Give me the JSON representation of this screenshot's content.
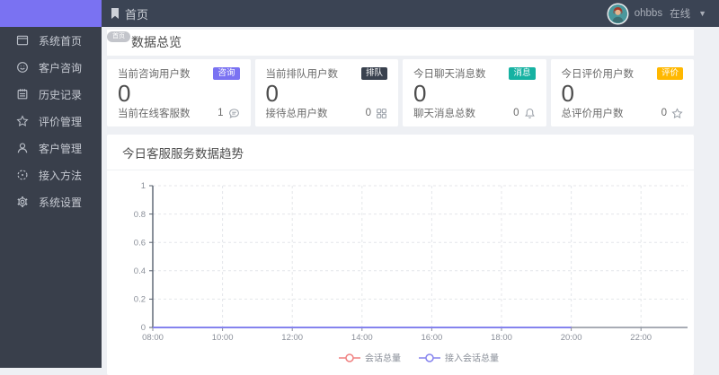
{
  "colors": {
    "logo_purple": "#7a72f2",
    "header_bg": "#3b4454",
    "sidebar_bg": "#393f4b",
    "page_bg": "#eef0f4",
    "axis_y": "#57606e",
    "axis_x": "#a8acb5",
    "grid_line": "#e4e6ea",
    "tick_label": "#8a8f99"
  },
  "header": {
    "breadcrumb": "首页",
    "username": "ohbbs",
    "status": "在线"
  },
  "sidebar": {
    "items": [
      {
        "label": "系统首页",
        "icon": "window-icon"
      },
      {
        "label": "客户咨询",
        "icon": "chat-smile-icon"
      },
      {
        "label": "历史记录",
        "icon": "notebook-icon"
      },
      {
        "label": "评价管理",
        "icon": "star-icon"
      },
      {
        "label": "客户管理",
        "icon": "user-icon"
      },
      {
        "label": "接入方法",
        "icon": "plug-circle-icon"
      },
      {
        "label": "系统设置",
        "icon": "gear-icon"
      }
    ]
  },
  "overview": {
    "tab_tag": "首页",
    "title": "数据总览",
    "cards": [
      {
        "title": "当前咨询用户数",
        "badge": "咨询",
        "badge_color": "#7a72f2",
        "value": "0",
        "footer_label": "当前在线客服数",
        "footer_value": "1",
        "footer_icon": "service-bubble-icon"
      },
      {
        "title": "当前排队用户数",
        "badge": "排队",
        "badge_color": "#39414e",
        "value": "0",
        "footer_label": "接待总用户数",
        "footer_value": "0",
        "footer_icon": "grid-icon"
      },
      {
        "title": "今日聊天消息数",
        "badge": "消息",
        "badge_color": "#16b2a2",
        "value": "0",
        "footer_label": "聊天消息总数",
        "footer_value": "0",
        "footer_icon": "bell-icon"
      },
      {
        "title": "今日评价用户数",
        "badge": "评价",
        "badge_color": "#ffb800",
        "value": "0",
        "footer_label": "总评价用户数",
        "footer_value": "0",
        "footer_icon": "star-icon"
      }
    ]
  },
  "trend": {
    "title": "今日客服服务数据趋势",
    "chart_data": {
      "type": "line",
      "x_tick_labels": [
        "08:00",
        "10:00",
        "12:00",
        "14:00",
        "16:00",
        "18:00",
        "20:00",
        "22:00"
      ],
      "y_ticks": [
        0,
        0.2,
        0.4,
        0.6,
        0.8,
        1
      ],
      "ylim": [
        0,
        1
      ],
      "grid": true,
      "legend_position": "bottom",
      "series": [
        {
          "name": "会话总量",
          "color": "#f08080",
          "x": [
            "08:00",
            "10:00",
            "12:00",
            "14:00",
            "16:00",
            "18:00",
            "20:00"
          ],
          "values": [
            0,
            0,
            0,
            0,
            0,
            0,
            0
          ]
        },
        {
          "name": "接入会话总量",
          "color": "#8583ee",
          "x": [
            "08:00",
            "10:00",
            "12:00",
            "14:00",
            "16:00",
            "18:00",
            "20:00"
          ],
          "values": [
            0,
            0,
            0,
            0,
            0,
            0,
            0
          ]
        }
      ]
    }
  }
}
